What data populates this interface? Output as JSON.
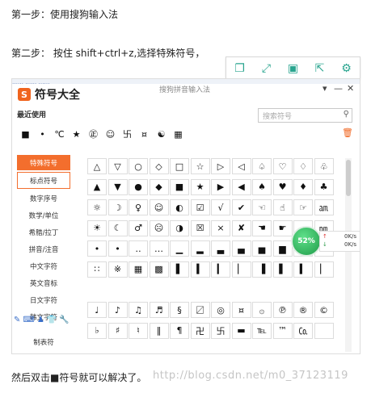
{
  "step1": "第一步：使用搜狗输入法",
  "step2": "第二步： 按住 shift+ctrl+z,选择特殊符号，",
  "step3": "然后双击■符号就可以解决了。",
  "watermark": "http://blog.csdn.net/m0_37123119",
  "toolbar": {
    "icons": [
      "copy-icon",
      "expand-icon",
      "save-icon",
      "share-icon",
      "gear-icon"
    ],
    "glyphs": [
      "❐",
      "⤢",
      "▣",
      "⇱",
      "⚙"
    ],
    "accent": "#2aa58f"
  },
  "window": {
    "top_strip": "…… …… ……",
    "logo": "S",
    "title": "符号大全",
    "subtitle": "搜狗拼音输入法",
    "controls": [
      "▾",
      "—",
      "✕"
    ],
    "recent_label": "最近使用",
    "search_placeholder": "搜索符号",
    "recent": [
      "■",
      "•",
      "℃",
      "★",
      "㊣",
      "☺",
      "卐",
      "¤",
      "☯",
      "▦"
    ],
    "accent": "#f36e2d",
    "sidebar": [
      "特殊符号",
      "标点符号",
      "数字序号",
      "数学/单位",
      "希腊/拉丁",
      "拼音/注音",
      "中文字符",
      "英文音标",
      "日文字符",
      "韩文字符"
    ],
    "sidebar_bottom": "制表符",
    "grid1": [
      [
        "△",
        "▽",
        "○",
        "◇",
        "□",
        "☆",
        "▷",
        "◁",
        "♤",
        "♡",
        "♢",
        "♧"
      ],
      [
        "▲",
        "▼",
        "●",
        "◆",
        "■",
        "★",
        "▶",
        "◀",
        "♠",
        "♥",
        "♦",
        "♣"
      ],
      [
        "☼",
        "☽",
        "♀",
        "☺",
        "◐",
        "☑",
        "√",
        "✔",
        "☜",
        "☝",
        "☞",
        "㏂"
      ],
      [
        "☀",
        "☾",
        "♂",
        "☹",
        "◑",
        "☒",
        "×",
        "✘",
        "☚",
        "☛",
        "",
        "㏘"
      ],
      [
        "•",
        "•",
        "‥",
        "…",
        "▁",
        "▂",
        "▃",
        "▄",
        "▅",
        "▆",
        "",
        ""
      ],
      [
        "∷",
        "※",
        "▦",
        "▩",
        "▌",
        "▍",
        "▎",
        "▏",
        "▐",
        "▌",
        "▍",
        "▏"
      ]
    ],
    "grid2": [
      [
        "♩",
        "♪",
        "♫",
        "♬",
        "§",
        "〼",
        "◎",
        "¤",
        "۞",
        "℗",
        "®",
        "©"
      ],
      [
        "♭",
        "♯",
        "♮",
        "‖",
        "¶",
        "卍",
        "卐",
        "▬",
        "℡",
        "™",
        "㏇",
        ""
      ]
    ],
    "net": {
      "percent": "52%",
      "up": "0K/s",
      "down": "0K/s",
      "up_arrow": "↑",
      "down_arrow": "↓",
      "plus": "+"
    }
  }
}
